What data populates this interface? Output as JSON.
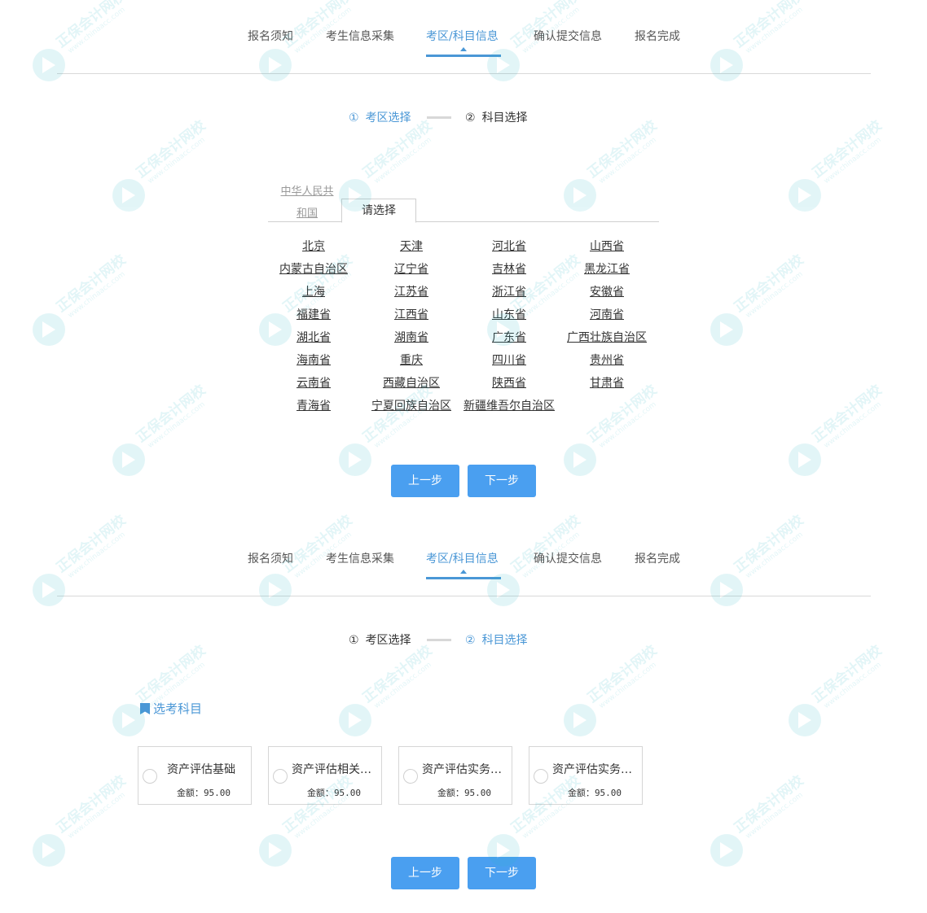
{
  "nav": {
    "items": [
      "报名须知",
      "考生信息采集",
      "考区/科目信息",
      "确认提交信息",
      "报名完成"
    ],
    "active_index": 2
  },
  "section1": {
    "steps": [
      {
        "num": "①",
        "label": "考区选择"
      },
      {
        "num": "②",
        "label": "科目选择"
      }
    ],
    "active_step": 0,
    "region_tabs": {
      "country_line1": "中华人民共",
      "country_line2": "和国",
      "select": "请选择"
    },
    "provinces": [
      "北京",
      "天津",
      "河北省",
      "山西省",
      "内蒙古自治区",
      "辽宁省",
      "吉林省",
      "黑龙江省",
      "上海",
      "江苏省",
      "浙江省",
      "安徽省",
      "福建省",
      "江西省",
      "山东省",
      "河南省",
      "湖北省",
      "湖南省",
      "广东省",
      "广西壮族自治区",
      "海南省",
      "重庆",
      "四川省",
      "贵州省",
      "云南省",
      "西藏自治区",
      "陕西省",
      "甘肃省",
      "青海省",
      "宁夏回族自治区",
      "新疆维吾尔自治区"
    ],
    "buttons": {
      "prev": "上一步",
      "next": "下一步"
    }
  },
  "section2": {
    "steps": [
      {
        "num": "①",
        "label": "考区选择"
      },
      {
        "num": "②",
        "label": "科目选择"
      }
    ],
    "active_step": 1,
    "subject_title": "选考科目",
    "subjects": [
      {
        "name": "资产评估基础",
        "price_label": "金额：",
        "price": "95.00"
      },
      {
        "name": "资产评估相关…",
        "price_label": "金额：",
        "price": "95.00"
      },
      {
        "name": "资产评估实务…",
        "price_label": "金额：",
        "price": "95.00"
      },
      {
        "name": "资产评估实务…",
        "price_label": "金额：",
        "price": "95.00"
      }
    ],
    "buttons": {
      "prev": "上一步",
      "next": "下一步"
    }
  },
  "watermark": {
    "brand": "正保会计网校",
    "url": "www.chinaacc.com"
  },
  "colors": {
    "accent": "#4a97d6",
    "button": "#4a9ff0",
    "watermark": "#2bb6c6"
  }
}
